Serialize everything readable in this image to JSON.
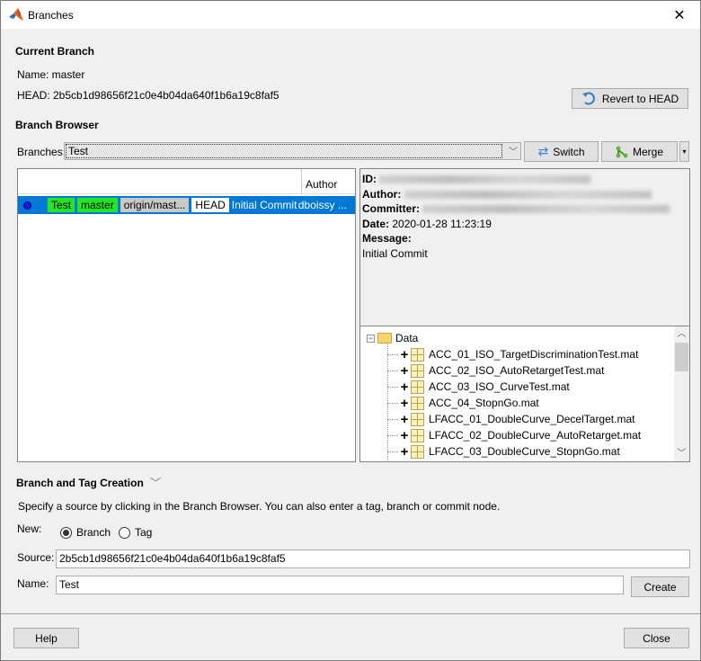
{
  "window": {
    "title": "Branches",
    "close_symbol": "✕"
  },
  "current_branch": {
    "heading": "Current Branch",
    "name_text": "Name: master",
    "head_text": "HEAD: 2b5cb1d98656f21c0e4b04da640f1b6a19c8faf5",
    "revert_label": "Revert to HEAD"
  },
  "branch_browser": {
    "heading": "Branch Browser",
    "branches_label": "Branches:",
    "branches_value": "Test",
    "switch_label": "Switch",
    "merge_label": "Merge",
    "columns": [
      "",
      "Author"
    ],
    "commits": [
      {
        "tags": [
          {
            "label": "Test",
            "style": "local"
          },
          {
            "label": "master",
            "style": "local"
          },
          {
            "label": "origin/mast...",
            "style": "remote"
          },
          {
            "label": "HEAD",
            "style": "head"
          }
        ],
        "message": "Initial Commit",
        "author": "dboissy ...",
        "selected": true
      }
    ],
    "details": {
      "id_label": "ID:",
      "author_label": "Author:",
      "committer_label": "Committer:",
      "date_label": "Date:",
      "date_value": "2020-01-28 11:23:19",
      "message_label": "Message:",
      "message_value": "Initial Commit"
    },
    "tree": {
      "root": "Data",
      "files": [
        "ACC_01_ISO_TargetDiscriminationTest.mat",
        "ACC_02_ISO_AutoRetargetTest.mat",
        "ACC_03_ISO_CurveTest.mat",
        "ACC_04_StopnGo.mat",
        "LFACC_01_DoubleCurve_DecelTarget.mat",
        "LFACC_02_DoubleCurve_AutoRetarget.mat",
        "LFACC_03_DoubleCurve_StopnGo.mat"
      ]
    }
  },
  "creation": {
    "heading": "Branch and Tag Creation",
    "instructions": "Specify a source by clicking in the Branch Browser. You can also enter a tag, branch or commit node.",
    "new_label": "New:",
    "options": [
      {
        "label": "Branch",
        "selected": true
      },
      {
        "label": "Tag",
        "selected": false
      }
    ],
    "source_label": "Source:",
    "source_value": "2b5cb1d98656f21c0e4b04da640f1b6a19c8faf5",
    "name_label": "Name:",
    "name_value": "Test",
    "create_label": "Create"
  },
  "footer": {
    "help_label": "Help",
    "close_label": "Close"
  },
  "colors": {
    "selection": "#0078d7",
    "local_branch_tag": "#22e722",
    "remote_branch_tag": "#c8c8c8"
  }
}
